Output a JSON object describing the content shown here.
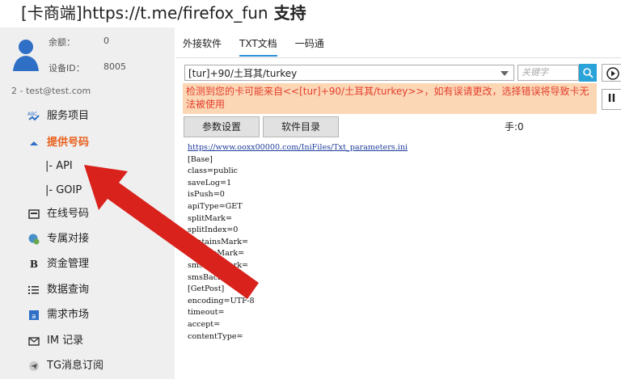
{
  "header": {
    "title_prefix": "[卡商端]",
    "title_url": "https://t.me/firefox_fun",
    "title_suffix": " 支持"
  },
  "sidebar": {
    "balance_label": "余额：",
    "balance_value": "0",
    "device_label": "设备ID：",
    "device_value": "8005",
    "account": "2 - test@test.com",
    "items": [
      {
        "label": "服务项目",
        "icon": "abc-icon"
      },
      {
        "label": "提供号码",
        "icon": "caret-up-icon",
        "active": true
      },
      {
        "label": "在线号码",
        "icon": "card-icon"
      },
      {
        "label": "专属对接",
        "icon": "globe-user-icon"
      },
      {
        "label": "资金管理",
        "icon": "bold-b-icon"
      },
      {
        "label": "数据查询",
        "icon": "list-icon"
      },
      {
        "label": "需求市场",
        "icon": "market-icon"
      },
      {
        "label": "IM 记录",
        "icon": "mail-icon"
      },
      {
        "label": "TG消息订阅",
        "icon": "telegram-icon"
      }
    ],
    "sub_items": [
      {
        "label": "|-  API"
      },
      {
        "label": "|-  GOIP"
      }
    ]
  },
  "tabs": [
    {
      "label": "外接软件"
    },
    {
      "label": "TXT文档",
      "active": true
    },
    {
      "label": "一码通"
    }
  ],
  "url_select": {
    "value": "[tur]+90/土耳其/turkey"
  },
  "keyword": {
    "placeholder": "关键字"
  },
  "warning": "检测到您的卡可能来自<<[tur]+90/土耳其/turkey>>，如有误请更改，选择错误将导致卡无法被使用",
  "buttons": {
    "params": "参数设置",
    "dir": "软件目录",
    "pause": "II"
  },
  "hand_label": "手:0",
  "content": {
    "link": "https://www.ooxx00000.com/IniFiles/Txt_parameters.ini",
    "lines": [
      "[Base]",
      "class=public",
      "saveLog=1",
      "isPush=0",
      "apiType=GET",
      "splitMark=",
      "splitIndex=0",
      "containsMark=",
      "replaceMark=",
      "smsForeMark=",
      "smsBackMark=",
      "[GetPost]",
      "encoding=UTF-8",
      "timeout=",
      "accept=",
      "contentType="
    ]
  },
  "colors": {
    "accent": "#e8601c",
    "tab_underline": "#2a8fd6",
    "warning_bg": "#fbd7b5",
    "warning_text": "#e53d2d",
    "arrow": "#d9221c"
  }
}
